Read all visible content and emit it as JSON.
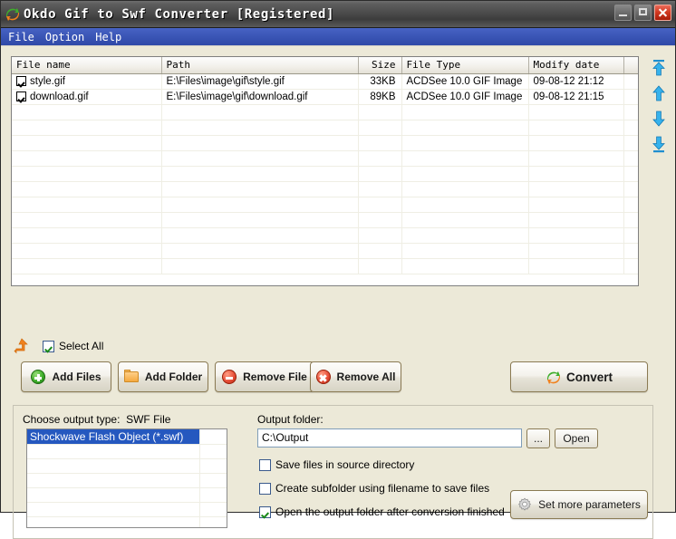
{
  "window": {
    "title": "Okdo Gif to Swf Converter [Registered]",
    "app_icon": "convert-swirl-icon",
    "buttons": {
      "minimize": "minimize-button",
      "maximize": "maximize-button",
      "close": "close-button"
    }
  },
  "menubar": {
    "items": [
      {
        "label": "File"
      },
      {
        "label": "Option"
      },
      {
        "label": "Help"
      }
    ]
  },
  "filelist": {
    "columns": [
      "File name",
      "Path",
      "Size",
      "File Type",
      "Modify date",
      ""
    ],
    "rows": [
      {
        "checked": true,
        "name": "style.gif",
        "path": "E:\\Files\\image\\gif\\style.gif",
        "size": "33KB",
        "type": "ACDSee 10.0 GIF Image",
        "modified": "09-08-12 21:12"
      },
      {
        "checked": true,
        "name": "download.gif",
        "path": "E:\\Files\\image\\gif\\download.gif",
        "size": "89KB",
        "type": "ACDSee 10.0 GIF Image",
        "modified": "09-08-12 21:15"
      }
    ],
    "empty_row_count": 11
  },
  "order_buttons": [
    {
      "name": "move-to-top-button"
    },
    {
      "name": "move-up-button"
    },
    {
      "name": "move-down-button"
    },
    {
      "name": "move-to-bottom-button"
    }
  ],
  "select_all": {
    "label": "Select All",
    "checked": true,
    "icon": "orange-up-arrow-icon"
  },
  "toolbar": {
    "add_files": "Add Files",
    "add_folder": "Add Folder",
    "remove_file": "Remove File",
    "remove_all": "Remove All",
    "convert": "Convert"
  },
  "output": {
    "type_label": "Choose output type:",
    "type_value": "SWF File",
    "type_options": [
      "Shockwave Flash Object (*.swf)"
    ],
    "selected_type": "Shockwave Flash Object (*.swf)",
    "folder_label": "Output folder:",
    "folder_value": "C:\\Output",
    "folder_placeholder": "Output folder",
    "browse_label": "...",
    "open_label": "Open",
    "set_params_label": "Set more parameters",
    "checkboxes": [
      {
        "label": "Save files in source directory",
        "checked": false
      },
      {
        "label": "Create subfolder using filename to save files",
        "checked": false
      },
      {
        "label": "Open the output folder after conversion finished",
        "checked": true
      }
    ]
  },
  "colors": {
    "menubar": "#3a55b5",
    "selection": "#2558bf",
    "accent_orange": "#f0821e",
    "accent_green": "#3fae2b",
    "arrow_blue": "#2e9fe0"
  }
}
